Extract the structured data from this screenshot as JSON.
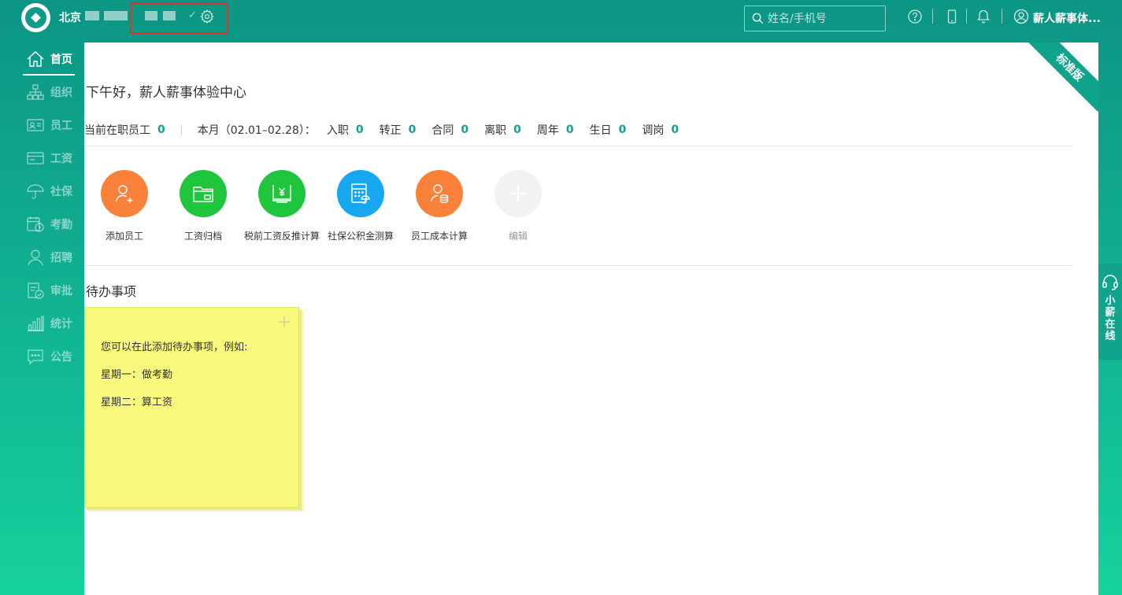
{
  "header": {
    "company_name": "北京",
    "search": {
      "placeholder": "姓名/手机号"
    },
    "user_name": "薪人薪事体..."
  },
  "sidebar": {
    "items": [
      {
        "label": "首页",
        "icon": "home-icon",
        "active": true
      },
      {
        "label": "组织",
        "icon": "org-chart-icon"
      },
      {
        "label": "员工",
        "icon": "id-card-icon"
      },
      {
        "label": "工资",
        "icon": "card-icon"
      },
      {
        "label": "社保",
        "icon": "umbrella-icon"
      },
      {
        "label": "考勤",
        "icon": "calendar-clock-icon"
      },
      {
        "label": "招聘",
        "icon": "person-icon"
      },
      {
        "label": "审批",
        "icon": "document-check-icon"
      },
      {
        "label": "统计",
        "icon": "bar-chart-icon"
      },
      {
        "label": "公告",
        "icon": "chat-bubble-icon"
      }
    ]
  },
  "main": {
    "edition_ribbon": "标准版",
    "greeting": "下午好，薪人薪事体验中心",
    "stats": {
      "current_employees_label": "当前在职员工",
      "current_employees_value": "0",
      "month_label": "本月（02.01–02.28）：",
      "items": [
        {
          "label": "入职",
          "value": "0"
        },
        {
          "label": "转正",
          "value": "0"
        },
        {
          "label": "合同",
          "value": "0"
        },
        {
          "label": "离职",
          "value": "0"
        },
        {
          "label": "周年",
          "value": "0"
        },
        {
          "label": "生日",
          "value": "0"
        },
        {
          "label": "调岗",
          "value": "0"
        }
      ]
    },
    "quick_actions": [
      {
        "label": "添加员工",
        "color": "#f9813a",
        "icon": "add-user-icon"
      },
      {
        "label": "工资归档",
        "color": "#1ec53d",
        "icon": "folder-icon"
      },
      {
        "label": "税前工资反推计算",
        "color": "#1ec53d",
        "icon": "yuan-calculator-icon"
      },
      {
        "label": "社保公积金测算",
        "color": "#15a7f0",
        "icon": "calculator-umbrella-icon"
      },
      {
        "label": "员工成本计算",
        "color": "#f9813a",
        "icon": "user-coins-icon"
      },
      {
        "label": "编辑",
        "color": "#f2f2f2",
        "icon": "plus-icon"
      }
    ],
    "todo": {
      "title": "待办事项",
      "lines": [
        "您可以在此添加待办事项，例如:",
        "星期一：做考勤",
        "星期二：算工资"
      ]
    }
  },
  "chat_tab": {
    "label": "小薪在线"
  },
  "colors": {
    "accent": "#11a48d",
    "highlight_box": "#e0322c",
    "sticky_note": "#f8f97c"
  }
}
